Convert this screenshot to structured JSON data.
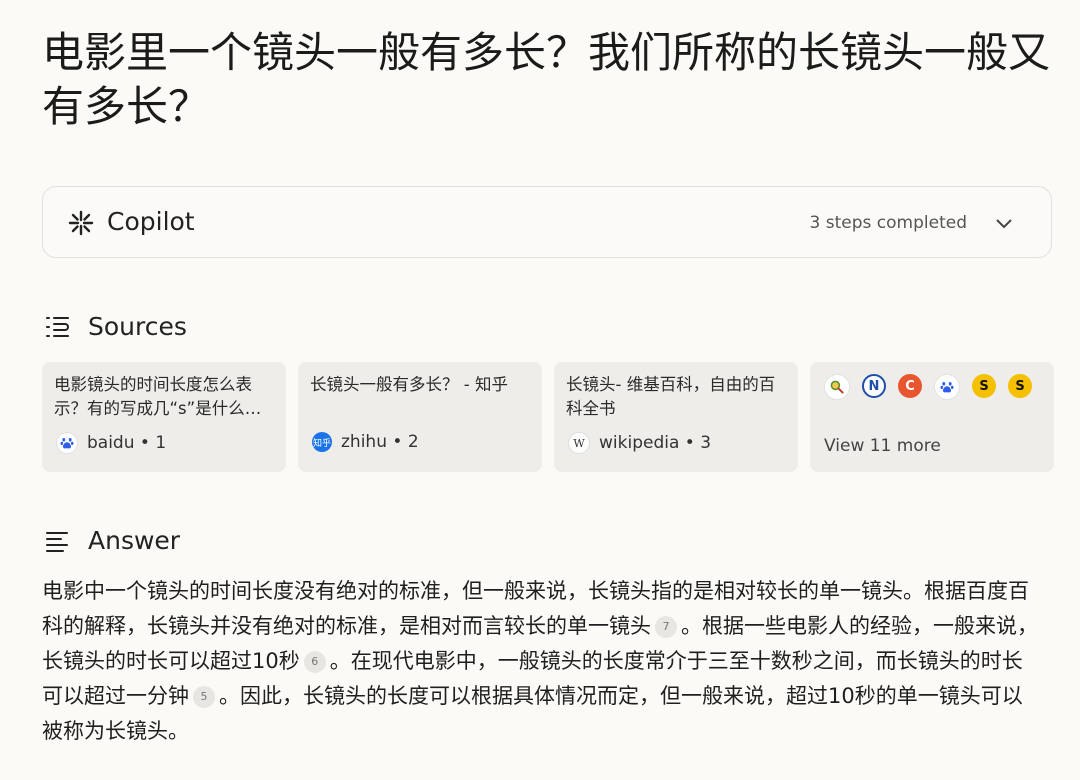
{
  "question": {
    "title": "电影里一个镜头一般有多长？我们所称的长镜头一般又有多长？"
  },
  "copilot": {
    "label": "Copilot",
    "status": "3 steps completed",
    "icon": "copilot-sparkle-icon"
  },
  "sources": {
    "heading": "Sources",
    "cards": [
      {
        "title": "电影镜头的时间长度怎么表示？有的写成几“s”是什么…",
        "source": "baidu",
        "index": "1",
        "icon": "baidu-icon"
      },
      {
        "title": "长镜头一般有多长？ - 知乎",
        "source": "zhihu",
        "index": "2",
        "icon": "zhihu-icon",
        "icon_text": "知乎"
      },
      {
        "title": "长镜头- 维基百科，自由的百科全书",
        "source": "wikipedia",
        "index": "3",
        "icon": "wikipedia-icon",
        "icon_text": "W"
      }
    ],
    "more": {
      "label": "View 11 more",
      "icons": [
        "magnifier-icon",
        "n-logo-icon",
        "c-logo-icon",
        "baidu-icon",
        "s-logo-icon",
        "s-logo-icon"
      ],
      "icon_text": [
        "",
        "N",
        "C",
        "",
        "S",
        "S"
      ]
    }
  },
  "answer": {
    "heading": "Answer",
    "parts": [
      "电影中一个镜头的时间长度没有绝对的标准，但一般来说，长镜头指的是相对较长的单一镜头。根据百度百科的解释，长镜头并没有绝对的标准，是相对而言较长的单一镜头",
      "。根据一些电影人的经验，一般来说，长镜头的时长可以超过10秒",
      "。在现代电影中，一般镜头的长度常介于三至十数秒之间，而长镜头的时长可以超过一分钟",
      "。因此，长镜头的长度可以根据具体情况而定，但一般来说，超过10秒的单一镜头可以被称为长镜头。"
    ],
    "citations": [
      "7",
      "6",
      "5"
    ]
  },
  "colors": {
    "background": "#fbfaf7",
    "card": "#efedea",
    "border": "#e2e0db",
    "text": "#1f1f1f"
  }
}
